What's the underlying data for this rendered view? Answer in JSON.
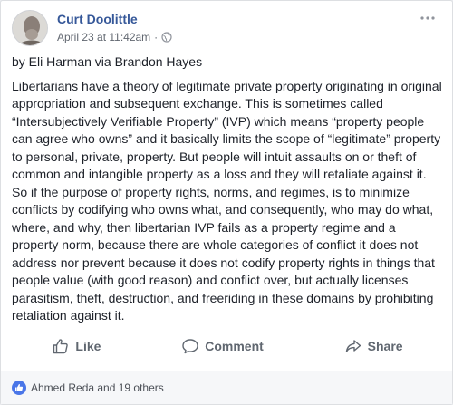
{
  "post": {
    "author": "Curt Doolittle",
    "timestamp": "April 23 at 11:42am",
    "separator": "·",
    "audience_icon": "globe-icon",
    "byline": "by Eli Harman via Brandon Hayes",
    "text": "Libertarians have a theory of legitimate private property originating in original appropriation and subsequent exchange. This is sometimes called “Intersubjectively Verifiable Property” (IVP) which means “property people can agree who owns” and it basically limits the scope of “legitimate” property to personal, private, property. But people will intuit assaults on or theft of common and intangible property as a loss and they will retaliate against it. So if the purpose of property rights, norms, and regimes, is to minimize conflicts by codifying who owns what, and consequently, who may do what, where, and why, then libertarian IVP fails as a property regime and a property norm, because there are whole categories of conflict it does not address nor prevent because it does not codify property rights in things that people value (with good reason) and conflict over, but actually licenses parasitism, theft, destruction, and freeriding in these domains by prohibiting retaliation against it."
  },
  "actions": {
    "like": "Like",
    "comment": "Comment",
    "share": "Share"
  },
  "reactions": {
    "summary": "Ahmed Reda and 19 others"
  },
  "colors": {
    "author_link": "#365899",
    "meta_text": "#616770",
    "action_text": "#606770",
    "like_badge": "#4a76e8"
  }
}
